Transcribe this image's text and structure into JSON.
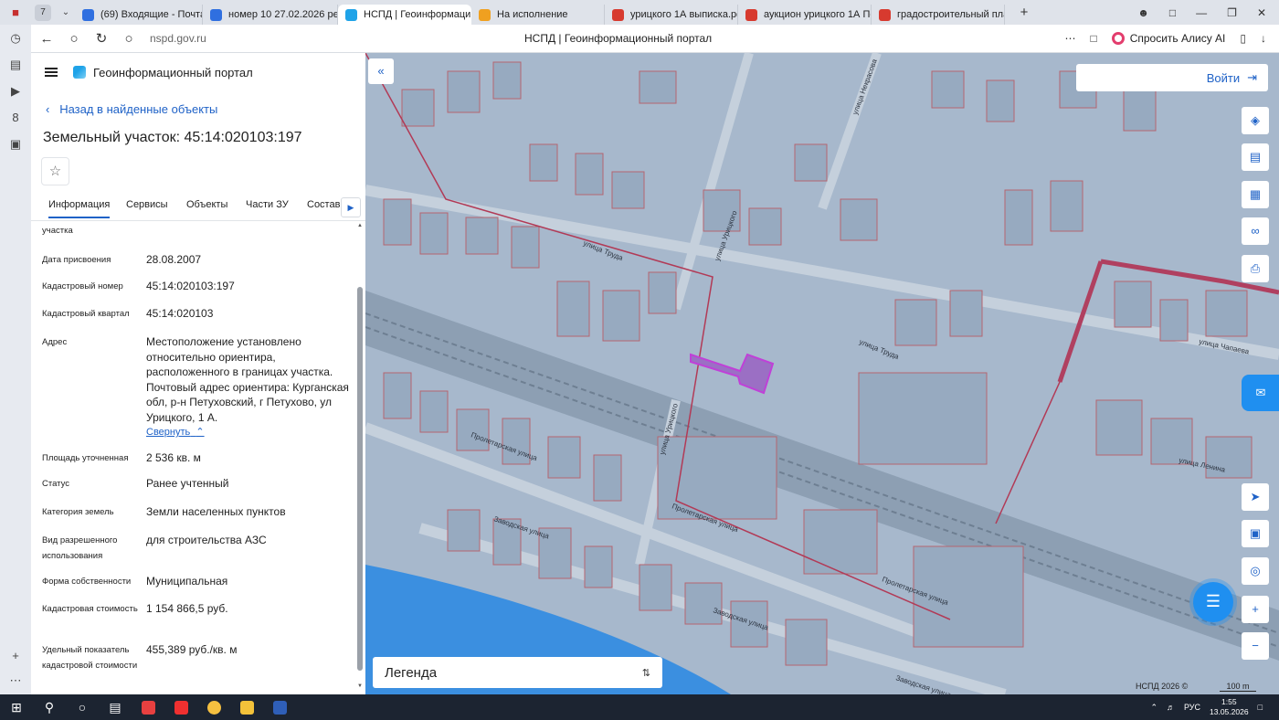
{
  "browser": {
    "tab_count": "7",
    "tabs": [
      {
        "label": "(69) Входящие - Почта Ma",
        "color": "#2f6fe0"
      },
      {
        "label": "номер 10 27.02.2026 реш",
        "color": "#2f6fe0"
      },
      {
        "label": "НСПД | Геоинформаци",
        "color": "#1fa3e8",
        "active": true
      },
      {
        "label": "На исполнение",
        "color": "#f0a020"
      },
      {
        "label": "урицкого 1А выписка.pdf",
        "color": "#d73a2f"
      },
      {
        "label": "аукцион урицкого 1А По",
        "color": "#d73a2f"
      },
      {
        "label": "градостроительный план",
        "color": "#d73a2f"
      }
    ],
    "url_host": "nspd.gov.ru",
    "page_title": "НСПД | Геоинформационный портал",
    "alice_label": "Спросить Алису AI"
  },
  "panel": {
    "portal_title": "Геоинформационный портал",
    "back_label": "Назад в найденные объекты",
    "object_title": "Земельный участок: 45:14:020103:197",
    "tabs": [
      "Информация",
      "Сервисы",
      "Объекты",
      "Части ЗУ",
      "Состав"
    ],
    "partial_top": "участка",
    "fields": [
      {
        "label": "Дата присвоения",
        "value": "28.08.2007"
      },
      {
        "label": "Кадастровый номер",
        "value": "45:14:020103:197"
      },
      {
        "label": "Кадастровый квартал",
        "value": "45:14:020103"
      },
      {
        "label": "Адрес",
        "value": "Местоположение установлено относительно ориентира, расположенного в границах участка. Почтовый адрес ориентира: Курганская обл, р-н Петуховский, г Петухово, ул Урицкого, 1 А."
      },
      {
        "label": "Площадь уточненная",
        "value": "2 536 кв. м"
      },
      {
        "label": "Статус",
        "value": "Ранее учтенный"
      },
      {
        "label": "Категория земель",
        "value": "Земли населенных пунктов"
      },
      {
        "label": "Вид разрешенного использования",
        "value": "для строительства АЗС"
      },
      {
        "label": "Форма собственности",
        "value": "Муниципальная"
      },
      {
        "label": "Кадастровая стоимость",
        "value": "1 154 866,5 руб."
      },
      {
        "label": "Удельный показатель кадастровой стоимости",
        "value": "455,389 руб./кв. м"
      }
    ],
    "collapse_label": "Свернуть"
  },
  "map": {
    "login_label": "Войти",
    "legend_label": "Легенда",
    "copyright": "НСПД 2026 ©",
    "scale": "100 m",
    "streets": [
      "улица Труда",
      "улица Труда",
      "улица Урицкого",
      "улица Урицкого",
      "Пролетарская улица",
      "Пролетарская улица",
      "Пролетарская улица",
      "Заводская улица",
      "Заводская улица",
      "Заводская улица",
      "улица Чапаева",
      "улица Ленина",
      "улица Некрасова"
    ],
    "highlight_color": "#b04bd0"
  },
  "taskbar": {
    "lang": "РУС",
    "time": "1:55",
    "date": "13.05.2026"
  }
}
